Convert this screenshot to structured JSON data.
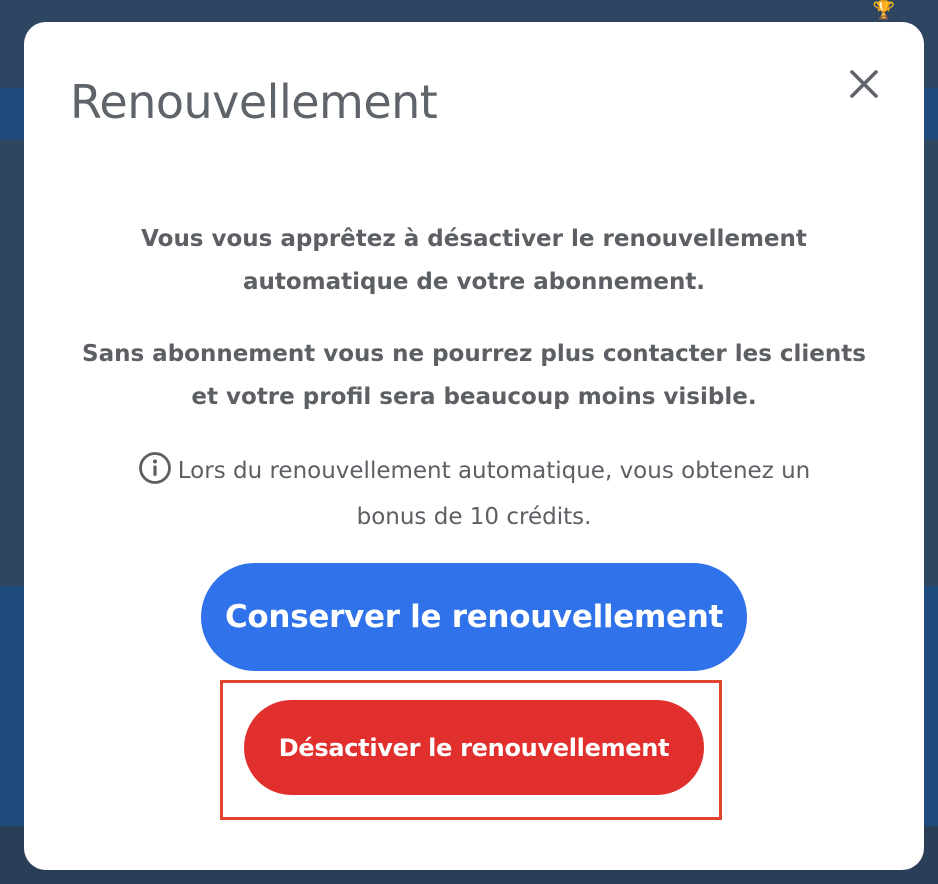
{
  "modal": {
    "title": "Renouvellement",
    "close_icon": "close-icon",
    "paragraph_1_line_1": "Vous vous apprêtez à désactiver le renouvellement",
    "paragraph_1_line_2": "automatique de votre abonnement.",
    "paragraph_2_line_1": "Sans abonnement vous ne pourrez plus contacter les clients",
    "paragraph_2_line_2": "et votre profil sera beaucoup moins visible.",
    "info_icon": "info-circle-icon",
    "info_line_1": "Lors du renouvellement automatique, vous obtenez un",
    "info_line_2": "bonus de 10 crédits.",
    "keep_button_label": "Conserver le renouvellement",
    "disable_button_label": "Désactiver le renouvellement"
  },
  "colors": {
    "primary_blue": "#2f72e9",
    "danger_red": "#e02f2c",
    "highlight_outline": "#e0432e",
    "text_gray": "#5c5f63"
  }
}
